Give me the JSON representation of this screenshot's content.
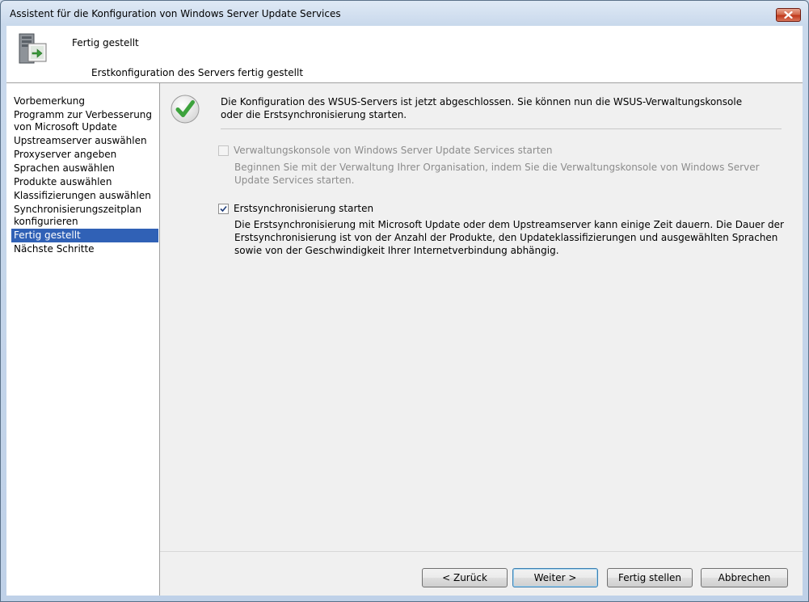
{
  "window": {
    "title": "Assistent für die Konfiguration von Windows Server Update Services"
  },
  "header": {
    "title": "Fertig gestellt",
    "subtitle": "Erstkonfiguration des Servers fertig gestellt",
    "icon": "server-setup-icon"
  },
  "sidebar": {
    "items": [
      {
        "label": "Vorbemerkung",
        "active": false
      },
      {
        "label": "Programm zur Verbesserung von Microsoft Update",
        "active": false
      },
      {
        "label": "Upstreamserver auswählen",
        "active": false
      },
      {
        "label": "Proxyserver angeben",
        "active": false
      },
      {
        "label": "Sprachen auswählen",
        "active": false
      },
      {
        "label": "Produkte auswählen",
        "active": false
      },
      {
        "label": "Klassifizierungen auswählen",
        "active": false
      },
      {
        "label": "Synchronisierungszeitplan konfigurieren",
        "active": false
      },
      {
        "label": "Fertig gestellt",
        "active": true
      },
      {
        "label": "Nächste Schritte",
        "active": false
      }
    ]
  },
  "main": {
    "intro": "Die Konfiguration des WSUS-Servers ist jetzt abgeschlossen. Sie können nun die WSUS-Verwaltungskonsole oder die Erstsynchronisierung starten.",
    "console_option": {
      "label": "Verwaltungskonsole von Windows Server Update Services starten",
      "checked": false,
      "enabled": false,
      "description": "Beginnen Sie mit der Verwaltung Ihrer Organisation, indem Sie die Verwaltungskonsole von Windows Server Update Services starten."
    },
    "sync_option": {
      "label": "Erstsynchronisierung starten",
      "checked": true,
      "enabled": true,
      "description": "Die Erstsynchronisierung mit Microsoft Update oder dem Upstreamserver kann einige Zeit dauern. Die Dauer der Erstsynchronisierung ist von der Anzahl der Produkte, den Updateklassifizierungen und ausgewählten Sprachen sowie von der Geschwindigkeit Ihrer Internetverbindung abhängig."
    }
  },
  "buttons": {
    "back": "< Zurück",
    "next": "Weiter >",
    "finish": "Fertig stellen",
    "cancel": "Abbrechen"
  },
  "colors": {
    "selection": "#3061b6",
    "content_bg": "#f0f0f0",
    "close_button": "#c0391c",
    "checkmark_green": "#3ca23c"
  }
}
